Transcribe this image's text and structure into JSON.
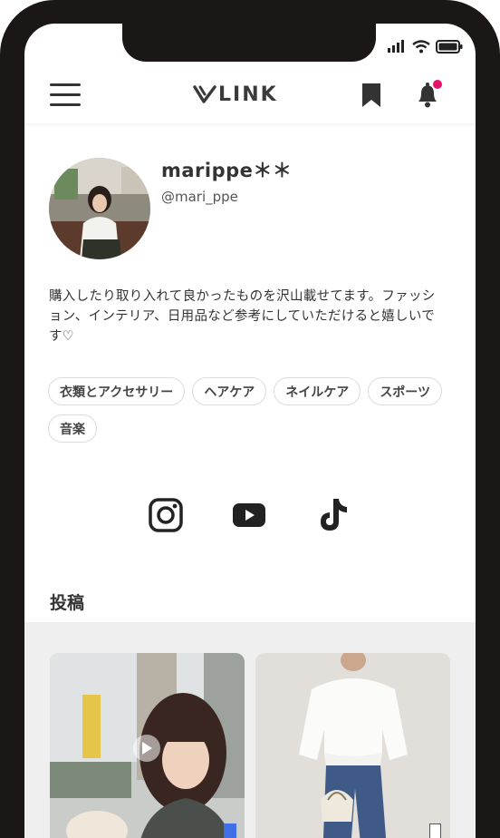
{
  "app": {
    "logo_text": "LINK",
    "accent_color": "#e5136b"
  },
  "header": {
    "menu_icon": "hamburger-icon",
    "bookmark_icon": "bookmark-icon",
    "bell_icon": "bell-icon"
  },
  "profile": {
    "name": "marippe＊＊",
    "handle": "@mari_ppe",
    "bio": "購入したり取り入れて良かったものを沢山載せてます。ファッション、インテリア、日用品など参考にしていただけると嬉しいです♡",
    "tags": [
      "衣類とアクセサリー",
      "ヘアケア",
      "ネイルケア",
      "スポーツ",
      "音楽"
    ]
  },
  "socials": [
    "instagram-icon",
    "youtube-icon",
    "tiktok-icon"
  ],
  "posts": {
    "title": "投稿",
    "items": [
      {
        "type": "video",
        "badge_color": "#3f6ee8"
      },
      {
        "type": "image",
        "badge_color": "#ffffff"
      }
    ]
  }
}
